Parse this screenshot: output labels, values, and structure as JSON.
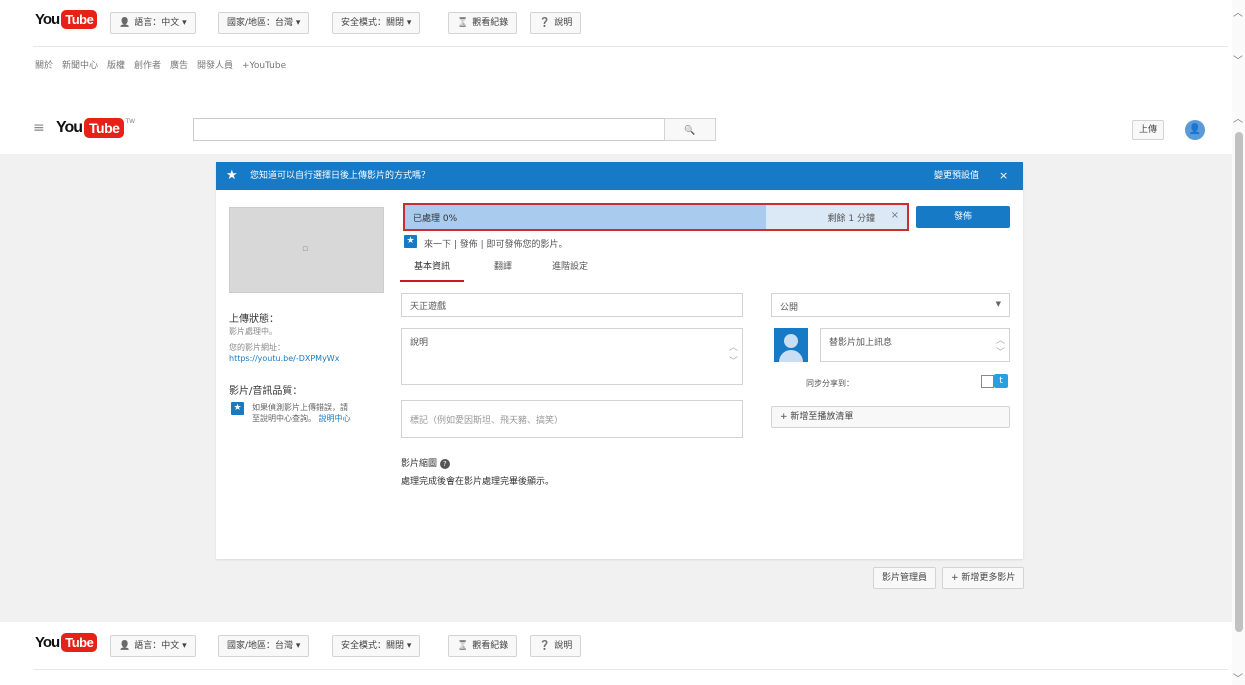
{
  "top_header": {
    "logo_you": "You",
    "logo_tube": "Tube",
    "pills": [
      {
        "icon": "person-icon",
        "glyph": "👤",
        "label": "語言：中文 ▾"
      },
      {
        "icon": "",
        "glyph": "",
        "label": "國家/地區：台灣 ▾"
      },
      {
        "icon": "",
        "glyph": "",
        "label": "安全模式：關閉 ▾"
      },
      {
        "icon": "hourglass-icon",
        "glyph": "⌛",
        "label": "觀看紀錄"
      },
      {
        "icon": "help-icon",
        "glyph": "❓",
        "label": "說明"
      }
    ],
    "footer_links": "關於　新聞中心　版權　創作者　廣告　開發人員　+YouTube"
  },
  "masthead": {
    "menu_glyph": "≡",
    "logo_you": "You",
    "logo_tube": "Tube",
    "logo_tw": "TW",
    "search_placeholder": "",
    "search_glyph": "🔍",
    "upload_label": "上傳",
    "avatar_glyph": "👤"
  },
  "banner": {
    "star_glyph": "★",
    "text": "您知道可以自行選擇日後上傳影片的方式嗎？",
    "settings_label": "變更預設值",
    "close_glyph": "×"
  },
  "upload_card": {
    "thumbnail_glyph": "▫",
    "status_title": "上傳狀態：",
    "status_value": "影片處理中。",
    "link_label": "您的影片網址：",
    "link_url": "https://youtu.be/-DXPMyWx",
    "quality_title": "影片/音訊品質：",
    "quality_text": "如果偵測影片上傳錯誤，請至說明中心查詢。",
    "quality_link": "說明中心",
    "progress_label": "已處理 0%",
    "progress_percent": 0.72,
    "progress_remaining": "剩餘 1 分鐘",
    "progress_cancel": "×",
    "publish_label": "發佈",
    "notify_label": "來一下 | 發佈 | 即可發佈您的影片。",
    "tabs": [
      "基本資訊",
      "翻譯",
      "進階設定"
    ],
    "title_value": "天正遊戲",
    "desc_placeholder": "說明",
    "tags_placeholder": "標記（例如愛因斯坦、飛天豬、搞笑）",
    "visibility_value": "公開",
    "share_placeholder": "替影片加上訊息",
    "share_twitter_label": "同步分享到：",
    "playlist_label": "+ 新增至播放清單",
    "thumbnail_section_title": "影片縮圖",
    "thumbnail_section_text": "處理完成後會在影片處理完畢後顯示。"
  },
  "bottom_buttons": {
    "manager_label": "影片管理員",
    "add_more_label": "+ 新增更多影片"
  },
  "bottom_header": {
    "logo_you": "You",
    "logo_tube": "Tube",
    "pills": [
      {
        "icon": "person-icon",
        "glyph": "👤",
        "label": "語言：中文 ▾"
      },
      {
        "icon": "",
        "glyph": "",
        "label": "國家/地區：台灣 ▾"
      },
      {
        "icon": "",
        "glyph": "",
        "label": "安全模式：關閉 ▾"
      },
      {
        "icon": "hourglass-icon",
        "glyph": "⌛",
        "label": "觀看紀錄"
      },
      {
        "icon": "help-icon",
        "glyph": "❓",
        "label": "說明"
      }
    ]
  },
  "colors": {
    "brand_red": "#e62117",
    "accent_blue": "#167ac6",
    "highlight_red": "#cc2d2d"
  }
}
